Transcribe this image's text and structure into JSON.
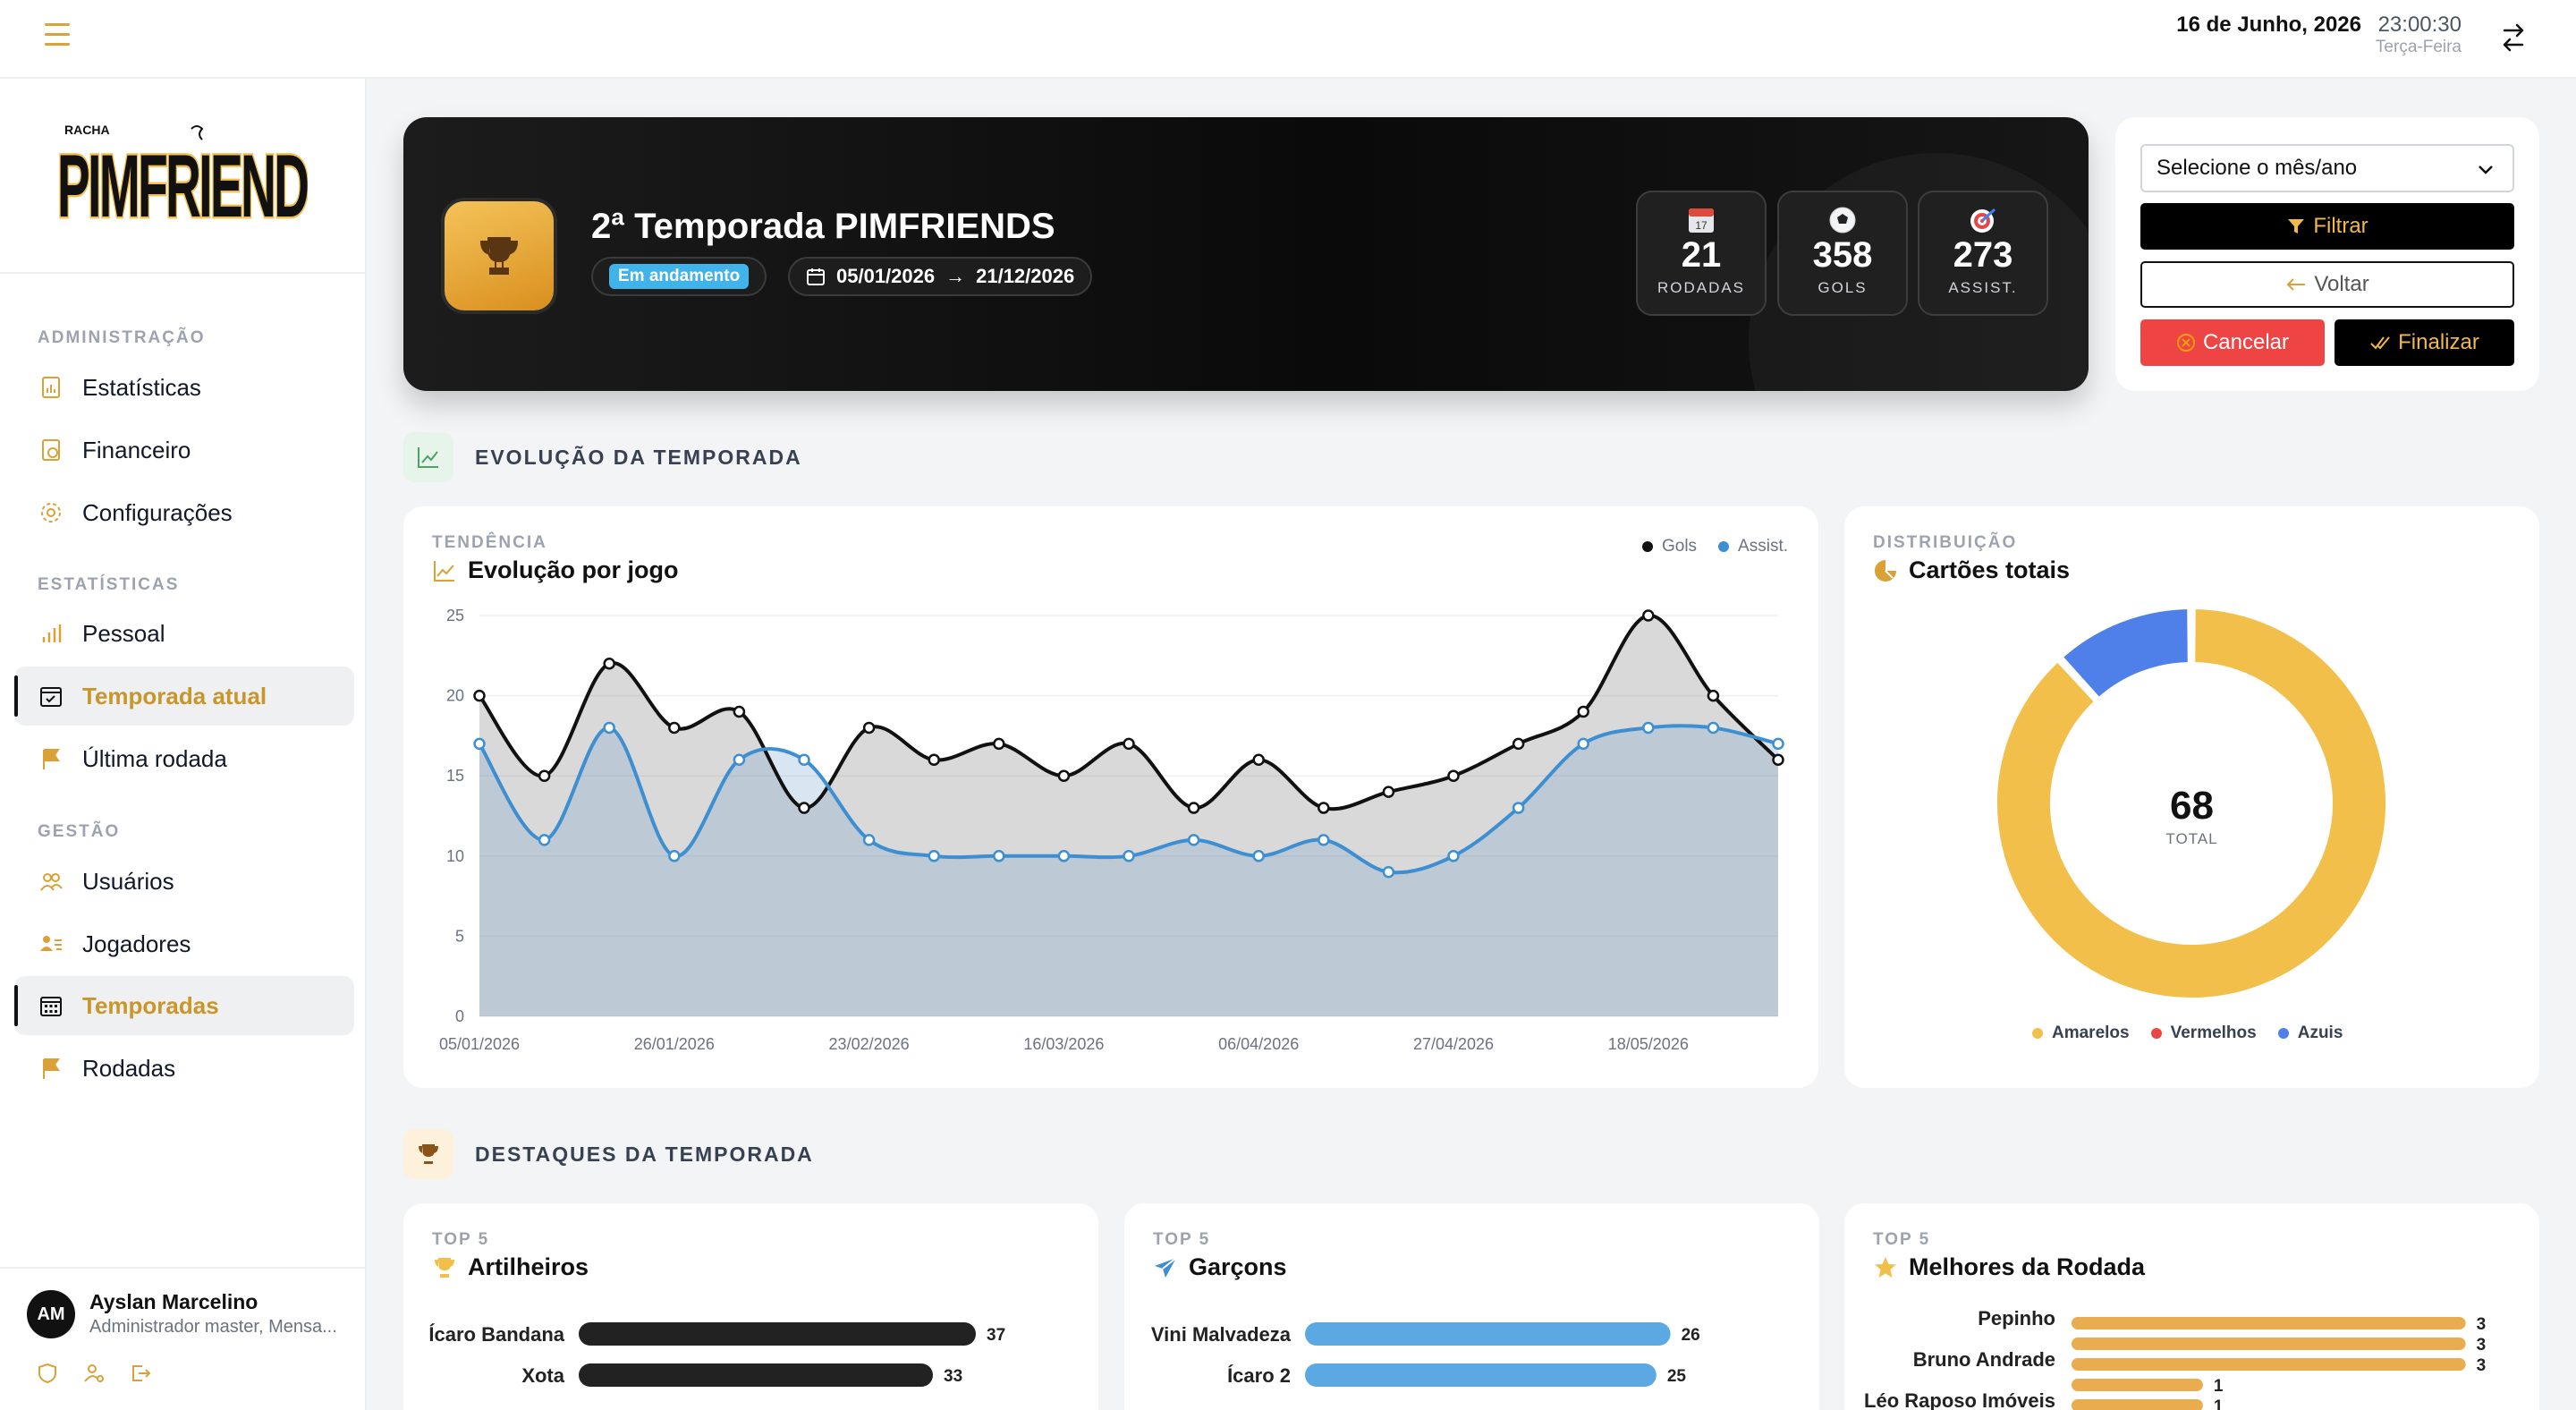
{
  "topbar": {
    "date": "16 de Junho, 2026",
    "time": "23:00:30",
    "weekday": "Terça-Feira"
  },
  "sidebar": {
    "logo_small": "RACHA",
    "logo_text": "PIMFRIENDS",
    "groups": [
      {
        "title": "ADMINISTRAÇÃO",
        "items": [
          {
            "label": "Estatísticas",
            "icon": "chart-document-icon"
          },
          {
            "label": "Financeiro",
            "icon": "money-document-icon"
          },
          {
            "label": "Configurações",
            "icon": "gear-icon"
          }
        ]
      },
      {
        "title": "ESTATÍSTICAS",
        "items": [
          {
            "label": "Pessoal",
            "icon": "bar-chart-icon"
          },
          {
            "label": "Temporada atual",
            "icon": "calendar-check-icon",
            "active": true
          },
          {
            "label": "Última rodada",
            "icon": "flag-icon"
          }
        ]
      },
      {
        "title": "GESTÃO",
        "items": [
          {
            "label": "Usuários",
            "icon": "users-icon"
          },
          {
            "label": "Jogadores",
            "icon": "player-list-icon"
          },
          {
            "label": "Temporadas",
            "icon": "calendar-grid-icon",
            "active": true
          },
          {
            "label": "Rodadas",
            "icon": "flag-icon"
          }
        ]
      }
    ],
    "user": {
      "initials": "AM",
      "name": "Ayslan Marcelino",
      "role": "Administrador master, Mensa..."
    }
  },
  "hero": {
    "title": "2ª Temporada PIMFRIENDS",
    "status": "Em andamento",
    "start_date": "05/01/2026",
    "arrow": "→",
    "end_date": "21/12/2026",
    "stats": [
      {
        "value": "21",
        "label": "RODADAS",
        "icon": "calendar-icon"
      },
      {
        "value": "358",
        "label": "GOLS",
        "icon": "soccer-ball-icon"
      },
      {
        "value": "273",
        "label": "ASSIST.",
        "icon": "target-icon"
      }
    ]
  },
  "filters": {
    "select_placeholder": "Selecione o mês/ano",
    "filtrar": "Filtrar",
    "voltar": "Voltar",
    "cancelar": "Cancelar",
    "finalizar": "Finalizar"
  },
  "sections": {
    "evolucao": "EVOLUÇÃO DA TEMPORADA",
    "destaques": "DESTAQUES DA TEMPORADA"
  },
  "colors": {
    "accent": "#d9a136",
    "gols": "#111111",
    "assist": "#3d8fd1",
    "amarelos": "#f2bf4b",
    "vermelhos": "#ef4444",
    "azuis": "#4f7fe8"
  },
  "chart_data": [
    {
      "type": "line",
      "kicker": "TENDÊNCIA",
      "title": "Evolução por jogo",
      "x_tick_labels": [
        "05/01/2026",
        "26/01/2026",
        "23/02/2026",
        "16/03/2026",
        "06/04/2026",
        "27/04/2026",
        "18/05/2026"
      ],
      "x_tick_indices": [
        0,
        3,
        6,
        9,
        12,
        15,
        18
      ],
      "ylim": [
        0,
        25
      ],
      "yticks": [
        0,
        5,
        10,
        15,
        20,
        25
      ],
      "grid": true,
      "legend_position": "top-right",
      "series": [
        {
          "name": "Gols",
          "values": [
            20,
            15,
            22,
            18,
            19,
            13,
            18,
            16,
            17,
            15,
            17,
            13,
            16,
            13,
            14,
            15,
            17,
            19,
            25,
            20,
            16
          ]
        },
        {
          "name": "Assist.",
          "values": [
            17,
            11,
            18,
            10,
            16,
            16,
            11,
            10,
            10,
            10,
            10,
            11,
            10,
            11,
            9,
            10,
            13,
            17,
            18,
            18,
            17
          ]
        }
      ]
    },
    {
      "type": "pie",
      "kicker": "DISTRIBUIÇÃO",
      "title": "Cartões totais",
      "center_value": "68",
      "center_label": "TOTAL",
      "legend_position": "bottom",
      "slices": [
        {
          "name": "Amarelos",
          "value": 60
        },
        {
          "name": "Vermelhos",
          "value": 0
        },
        {
          "name": "Azuis",
          "value": 8
        }
      ]
    },
    {
      "type": "bar",
      "kicker": "TOP 5",
      "title": "Artilheiros",
      "categories": [
        "Ícaro Bandana",
        "Xota"
      ],
      "values": [
        37,
        33
      ],
      "xlim": [
        0,
        40
      ]
    },
    {
      "type": "bar",
      "kicker": "TOP 5",
      "title": "Garçons",
      "categories": [
        "Vini Malvadeza",
        "Ícaro 2"
      ],
      "values": [
        26,
        25
      ],
      "xlim": [
        0,
        28
      ]
    },
    {
      "type": "bar",
      "kicker": "TOP 5",
      "title": "Melhores da Rodada",
      "categories": [
        "Pepinho",
        "",
        "Bruno Andrade",
        "",
        "Léo Raposo Imóveis"
      ],
      "values": [
        3,
        3,
        3,
        1,
        1
      ],
      "xlim": [
        0,
        3.2
      ]
    }
  ]
}
